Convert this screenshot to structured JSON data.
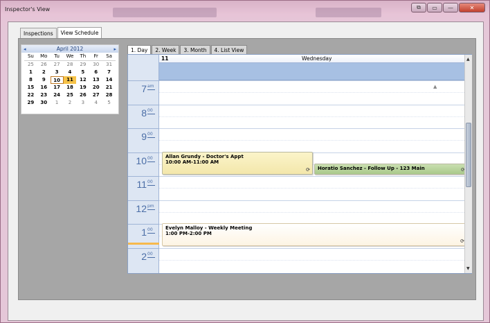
{
  "window": {
    "title": "Inspector's View",
    "buttons": [
      "⧉",
      "▭",
      "—",
      "✕"
    ]
  },
  "main_tabs": [
    {
      "label": "Inspections"
    },
    {
      "label": "View Schedule"
    }
  ],
  "mini_calendar": {
    "month_label": "April 2012",
    "prev": "◂",
    "next": "▸",
    "dow": [
      "Su",
      "Mo",
      "Tu",
      "We",
      "Th",
      "Fr",
      "Sa"
    ],
    "days": [
      [
        "25",
        "26",
        "27",
        "28",
        "29",
        "30",
        "31"
      ],
      [
        "1",
        "2",
        "3",
        "4",
        "5",
        "6",
        "7"
      ],
      [
        "8",
        "9",
        "10",
        "11",
        "12",
        "13",
        "14"
      ],
      [
        "15",
        "16",
        "17",
        "18",
        "19",
        "20",
        "21"
      ],
      [
        "22",
        "23",
        "24",
        "25",
        "26",
        "27",
        "28"
      ],
      [
        "29",
        "30",
        "1",
        "2",
        "3",
        "4",
        "5"
      ]
    ]
  },
  "view_tabs": [
    {
      "label": "1. Day"
    },
    {
      "label": "2. Week"
    },
    {
      "label": "3. Month"
    },
    {
      "label": "4. List View"
    }
  ],
  "day_header": {
    "number": "11",
    "name": "Wednesday"
  },
  "hours": [
    {
      "h": "7",
      "m": "am"
    },
    {
      "h": "8",
      "m": "00"
    },
    {
      "h": "9",
      "m": "00"
    },
    {
      "h": "10",
      "m": "00"
    },
    {
      "h": "11",
      "m": "00"
    },
    {
      "h": "12",
      "m": "pm"
    },
    {
      "h": "1",
      "m": "00"
    },
    {
      "h": "2",
      "m": "00"
    }
  ],
  "appointments": [
    {
      "title": "Allan Grundy - Doctor's Appt",
      "time": "10:00 AM-11:00 AM"
    },
    {
      "title": "Horatio Sanchez - Follow Up - 123 Main",
      "time": ""
    },
    {
      "title": "Evelyn Malloy - Weekly Meeting",
      "time": "1:00 PM-2:00 PM"
    }
  ]
}
